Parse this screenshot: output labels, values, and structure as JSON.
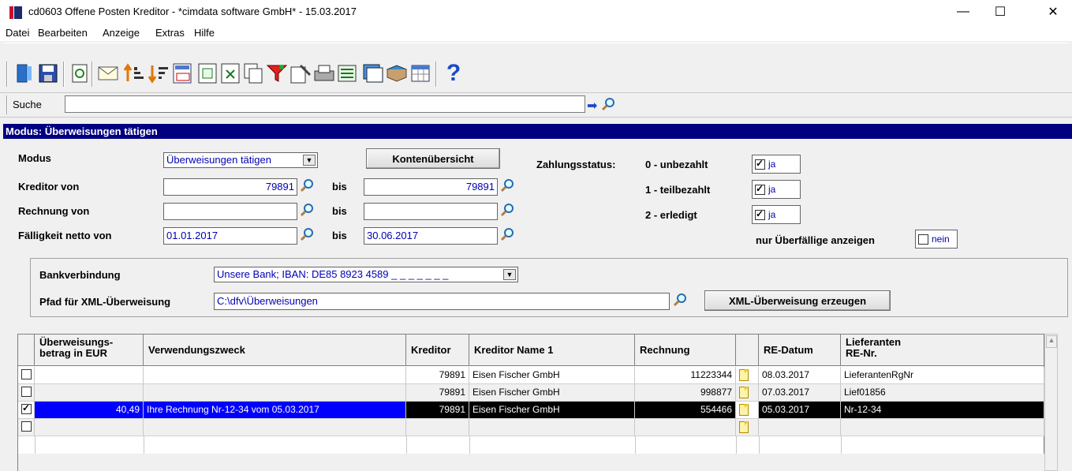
{
  "window": {
    "title": "cd0603 Offene Posten Kreditor - *cimdata software GmbH* - 15.03.2017",
    "minimize": "—",
    "maximize": "☐",
    "close": "✕"
  },
  "menu": [
    "Datei",
    "Bearbeiten",
    "Anzeige",
    "Extras",
    "Hilfe"
  ],
  "toolbar_icons": [
    "exit-icon",
    "save-icon",
    "refresh-icon",
    "email-icon",
    "sort-asc-icon",
    "sort-desc-icon",
    "calendar-icon",
    "export-icon",
    "delete-icon",
    "copy-icon",
    "filter-icon",
    "edit-icon",
    "print-icon",
    "list-icon",
    "window-icon",
    "book-icon",
    "table-icon",
    "help-icon"
  ],
  "search": {
    "label": "Suche",
    "value": ""
  },
  "mode_header": "Modus: Überweisungen tätigen",
  "form": {
    "modus_label": "Modus",
    "modus_value": "Überweisungen tätigen",
    "kontenuebersicht_button": "Kontenübersicht",
    "kreditor_label": "Kreditor von",
    "kreditor_von": "79891",
    "kreditor_bis": "79891",
    "rechnung_label": "Rechnung von",
    "rechnung_von": "",
    "rechnung_bis": "",
    "faelligkeit_label": "Fälligkeit netto von",
    "faelligkeit_von": "01.01.2017",
    "faelligkeit_bis": "30.06.2017",
    "bis": "bis",
    "zahlungsstatus_label": "Zahlungsstatus:",
    "status_0": "0 - unbezahlt",
    "status_1": "1 - teilbezahlt",
    "status_2": "2 - erledigt",
    "ja": "ja",
    "ueberfaellige_label": "nur Überfällige anzeigen",
    "nein": "nein"
  },
  "bank": {
    "bankverbindung_label": "Bankverbindung",
    "bankverbindung_value": "Unsere Bank; IBAN: DE85 8923 4589 _ _ _ _ _ _ _",
    "pfad_label": "Pfad für XML-Überweisung",
    "pfad_value": "C:\\dfv\\Überweisungen",
    "xml_button": "XML-Überweisung erzeugen"
  },
  "grid": {
    "headers": {
      "betrag_line1": "Überweisungs-",
      "betrag_line2": "betrag in EUR",
      "verwendungszweck": "Verwendungszweck",
      "kreditor": "Kreditor",
      "kreditor_name": "Kreditor Name 1",
      "rechnung": "Rechnung",
      "re_datum": "RE-Datum",
      "lief_line1": "Lieferanten",
      "lief_line2": "RE-Nr."
    },
    "rows": [
      {
        "checked": false,
        "betrag": "",
        "zweck": "",
        "kreditor": "79891",
        "name": "Eisen Fischer GmbH",
        "rechnung": "11223344",
        "datum": "08.03.2017",
        "lief": "LieferantenRgNr"
      },
      {
        "checked": false,
        "betrag": "",
        "zweck": "",
        "kreditor": "79891",
        "name": "Eisen Fischer GmbH",
        "rechnung": "998877",
        "datum": "07.03.2017",
        "lief": "Lief01856"
      },
      {
        "checked": true,
        "betrag": "40,49",
        "zweck": "Ihre Rechnung Nr-12-34 vom 05.03.2017",
        "kreditor": "79891",
        "name": "Eisen Fischer GmbH",
        "rechnung": "554466",
        "datum": "05.03.2017",
        "lief": "Nr-12-34"
      },
      {
        "checked": false,
        "betrag": "",
        "zweck": "",
        "kreditor": "",
        "name": "",
        "rechnung": "",
        "datum": "",
        "lief": ""
      }
    ]
  }
}
